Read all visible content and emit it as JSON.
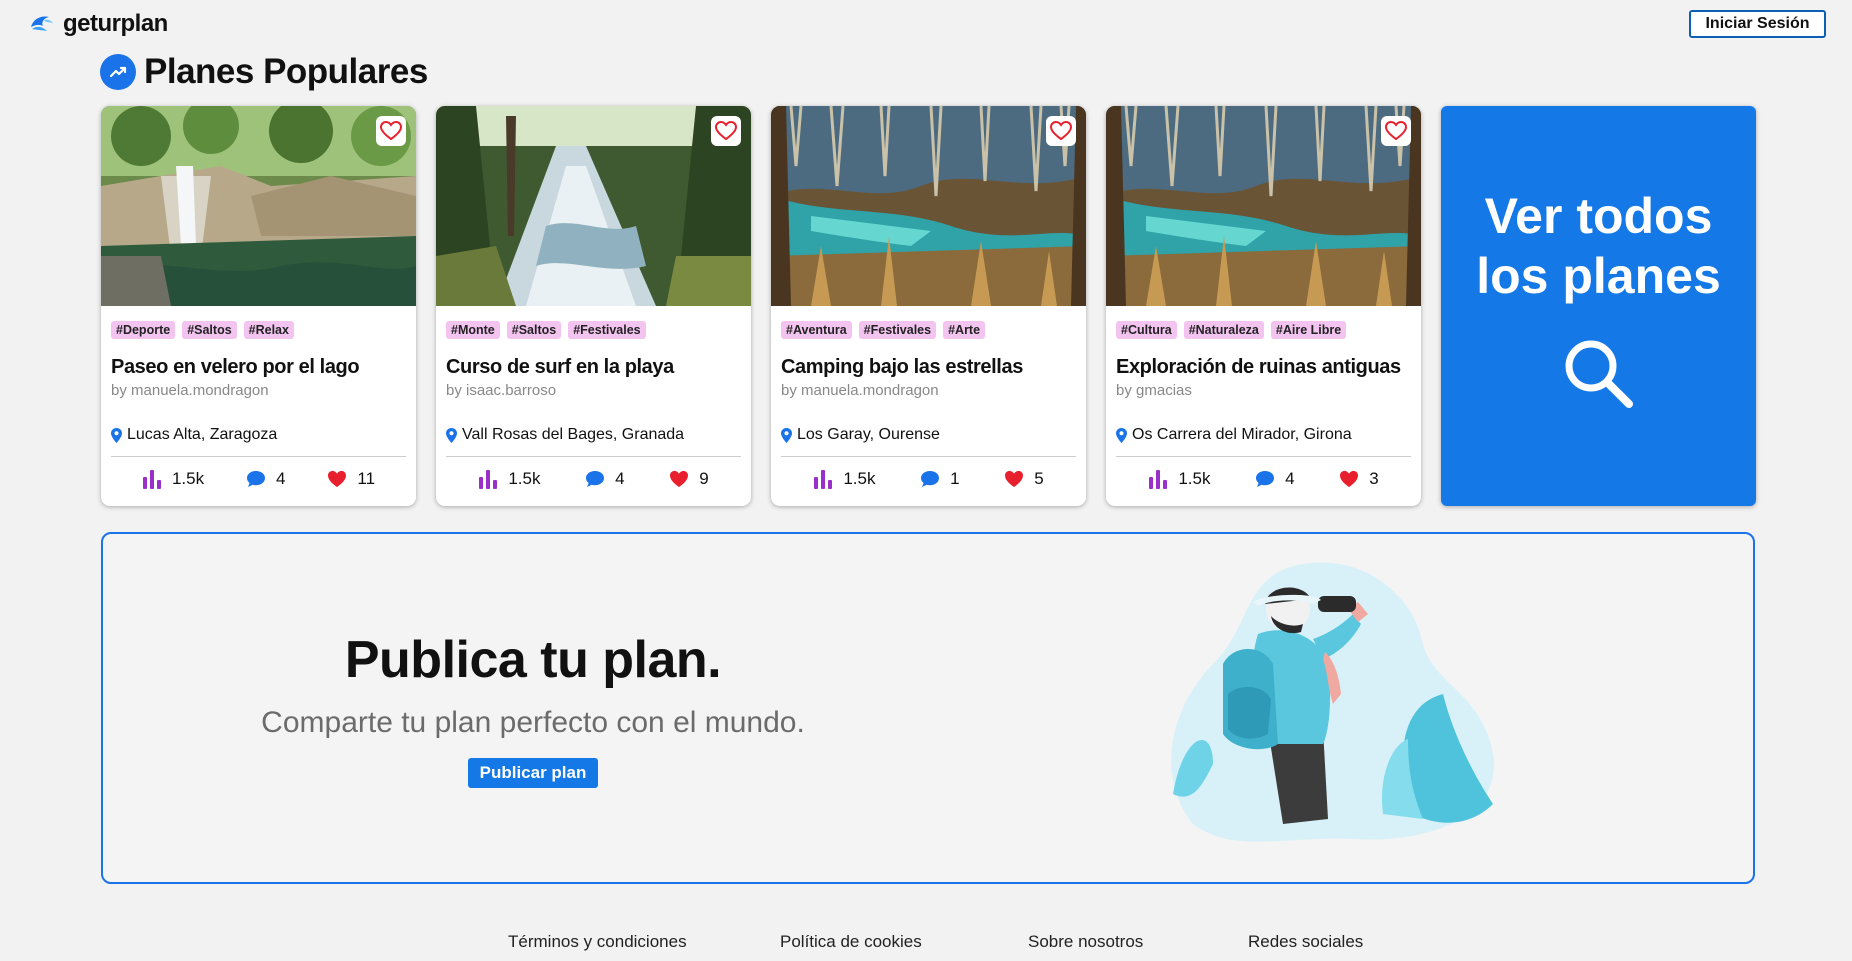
{
  "header": {
    "logo_text": "geturplan",
    "login_label": "Iniciar Sesión"
  },
  "section": {
    "title": "Planes Populares"
  },
  "cards": [
    {
      "tags": [
        "#Deporte",
        "#Saltos",
        "#Relax"
      ],
      "title": "Paseo en velero por el lago",
      "author": "by manuela.mondragon",
      "location": "Lucas Alta, Zaragoza",
      "views": "1.5k",
      "comments": "4",
      "likes": "11",
      "image": "waterfall"
    },
    {
      "tags": [
        "#Monte",
        "#Saltos",
        "#Festivales"
      ],
      "title": "Curso de surf en la playa",
      "author": "by isaac.barroso",
      "location": "Vall Rosas del Bages, Granada",
      "views": "1.5k",
      "comments": "4",
      "likes": "9",
      "image": "river"
    },
    {
      "tags": [
        "#Aventura",
        "#Festivales",
        "#Arte"
      ],
      "title": "Camping bajo las estrellas",
      "author": "by manuela.mondragon",
      "location": "Los Garay, Ourense",
      "views": "1.5k",
      "comments": "1",
      "likes": "5",
      "image": "cave"
    },
    {
      "tags": [
        "#Cultura",
        "#Naturaleza",
        "#Aire Libre"
      ],
      "title": "Exploración de ruinas antiguas",
      "author": "by gmacias",
      "location": "Os Carrera del Mirador, Girona",
      "views": "1.5k",
      "comments": "4",
      "likes": "3",
      "image": "cave"
    }
  ],
  "see_all": {
    "label": "Ver todos los planes",
    "icon": "search-icon"
  },
  "publish": {
    "title": "Publica tu plan.",
    "subtitle": "Comparte tu plan perfecto con el mundo.",
    "button_label": "Publicar plan"
  },
  "footer": {
    "links": [
      "Términos y condiciones",
      "Política de cookies",
      "Sobre nosotros",
      "Redes sociales"
    ]
  },
  "colors": {
    "accent": "#1478e6",
    "tag_bg": "#f3c4f0",
    "views_icon": "#9b30c8",
    "comments_icon": "#1a73e8",
    "likes_icon": "#e8202e"
  }
}
